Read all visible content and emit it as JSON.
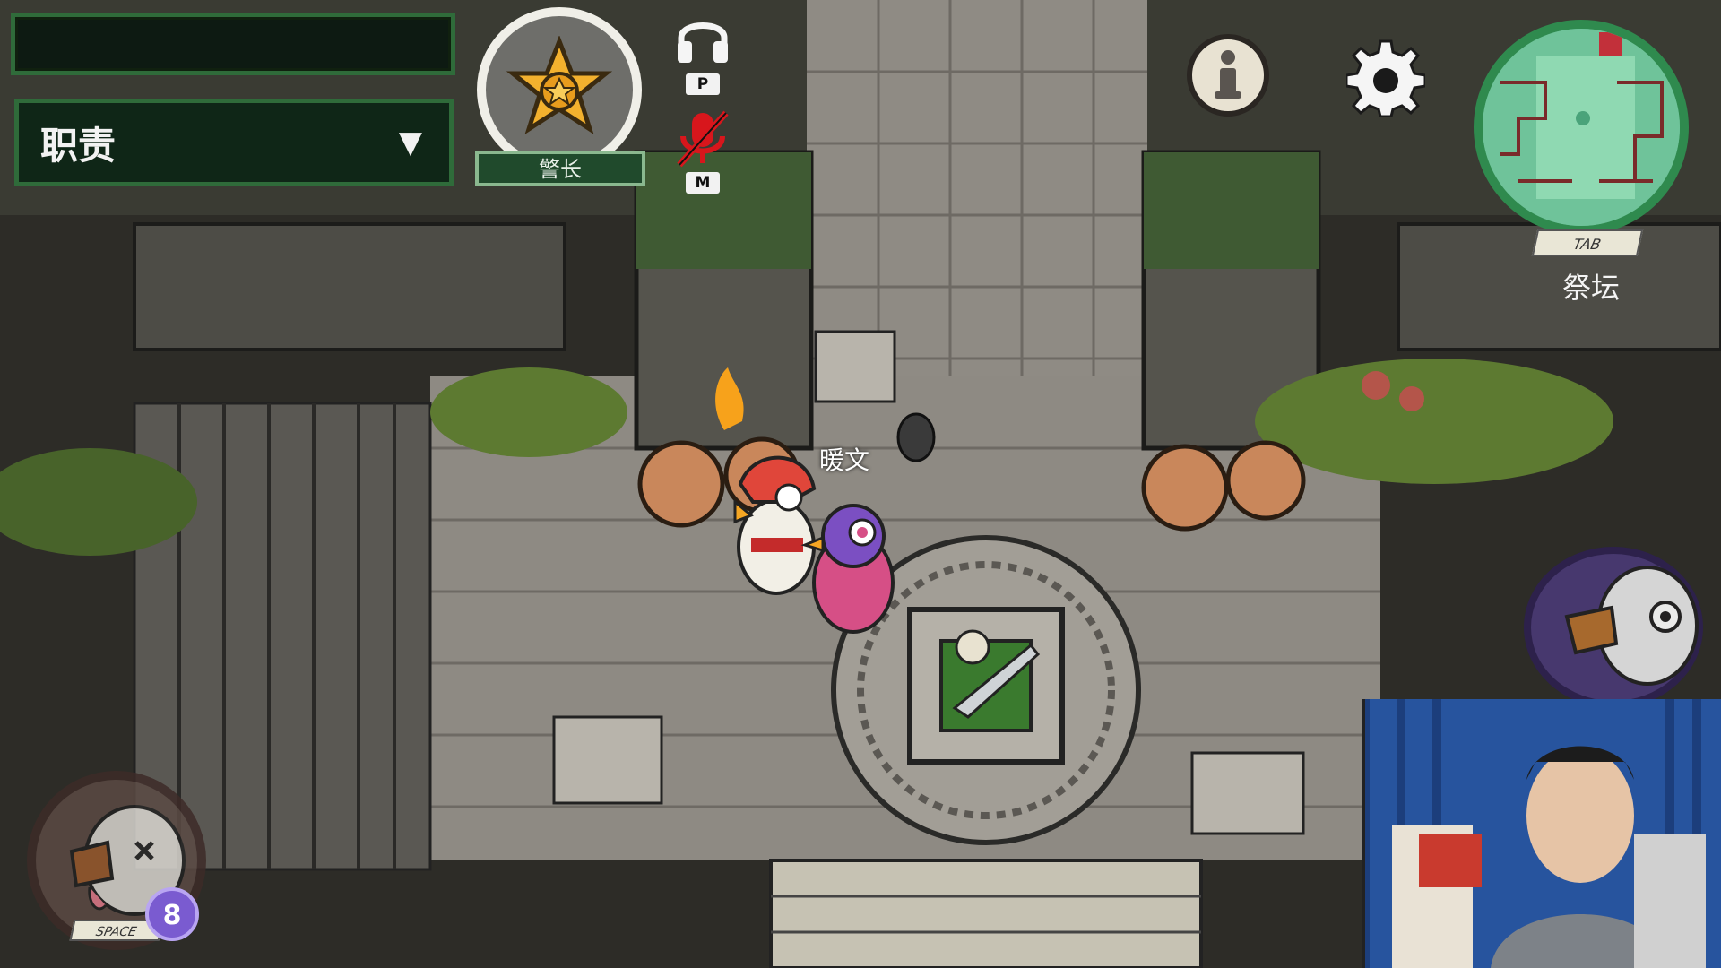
{
  "hud": {
    "name_bar_text": "",
    "duty_label": "职责",
    "duty_arrow": "▼",
    "role_label": "警长",
    "headphone_key": "P",
    "mic_key": "M",
    "minimap_key": "TAB",
    "room_name": "祭坛",
    "action_key": "SPACE",
    "ability_count": "8"
  },
  "world": {
    "player_name": "暖文"
  },
  "icons": {
    "role_badge": "sheriff-star-icon",
    "headphone": "headphones-icon",
    "mic": "mic-muted-icon",
    "info": "info-icon",
    "settings": "gear-icon",
    "report": "report-goose-icon",
    "ability": "dead-goose-icon"
  },
  "colors": {
    "hud_green": "#2f6b3a",
    "mic_muted": "#d8161c",
    "minimap_green": "#5fb58c",
    "ability_purple": "#7a5bd0"
  }
}
